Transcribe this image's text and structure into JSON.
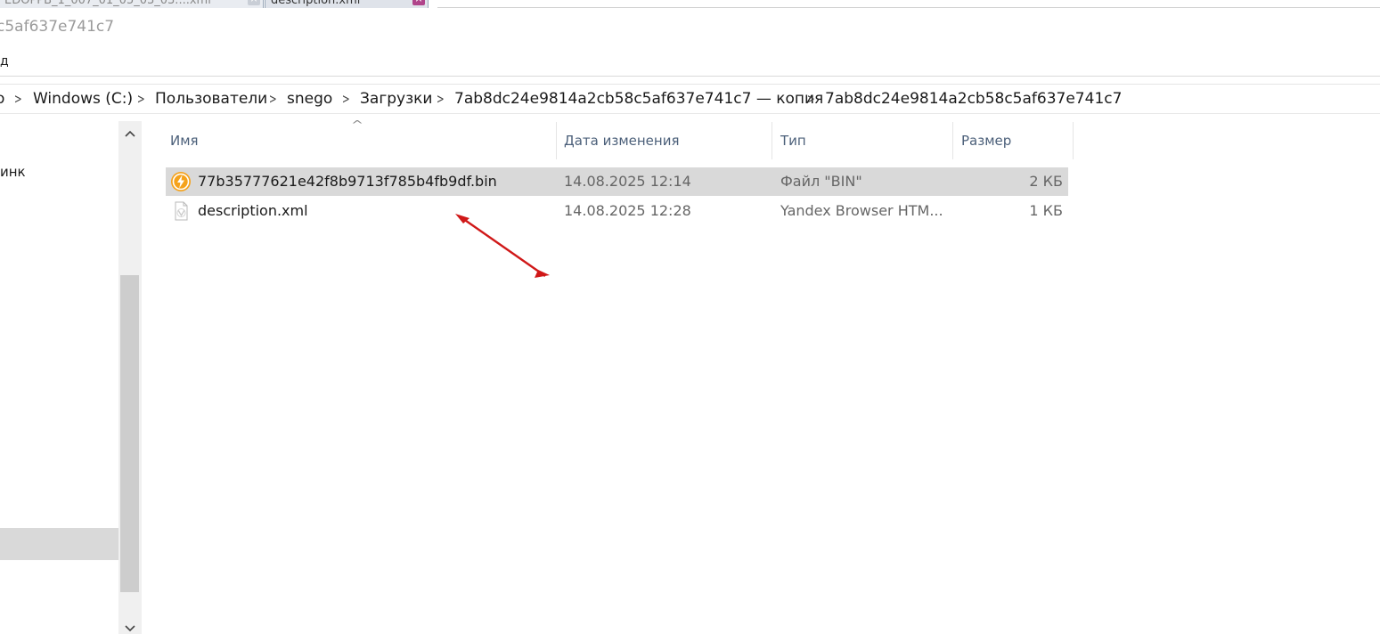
{
  "taskbar": {
    "tab1_label": "EDOPPB_1_007_01_05_03_03....xml",
    "tab2_label": "description.xml"
  },
  "window": {
    "title": "c5af637e741c7"
  },
  "ribbon": {
    "view_label": "д"
  },
  "breadcrumb": [
    "o",
    "Windows (C:)",
    "Пользователи",
    "snego",
    "Загрузки",
    "7ab8dc24e9814a2cb58c5af637e741c7 — копия",
    "7ab8dc24e9814a2cb58c5af637e741c7"
  ],
  "nav": {
    "partial_label": "инк"
  },
  "columns": {
    "name": "Имя",
    "date": "Дата изменения",
    "type": "Тип",
    "size": "Размер"
  },
  "files": [
    {
      "name": "77b35777621e42f8b9713f785b4fb9df.bin",
      "date": "14.08.2025 12:14",
      "type": "Файл \"BIN\"",
      "size": "2 КБ",
      "icon": "bolt-app-icon",
      "selected": true
    },
    {
      "name": "description.xml",
      "date": "14.08.2025 12:28",
      "type": "Yandex Browser HTM...",
      "size": "1 КБ",
      "icon": "xml-document-icon",
      "selected": false
    }
  ],
  "colors": {
    "selection": "#d9d9d9",
    "header_text": "#4c607a",
    "annotation_arrow": "#d01818",
    "bin_icon": "#f5a21b"
  }
}
